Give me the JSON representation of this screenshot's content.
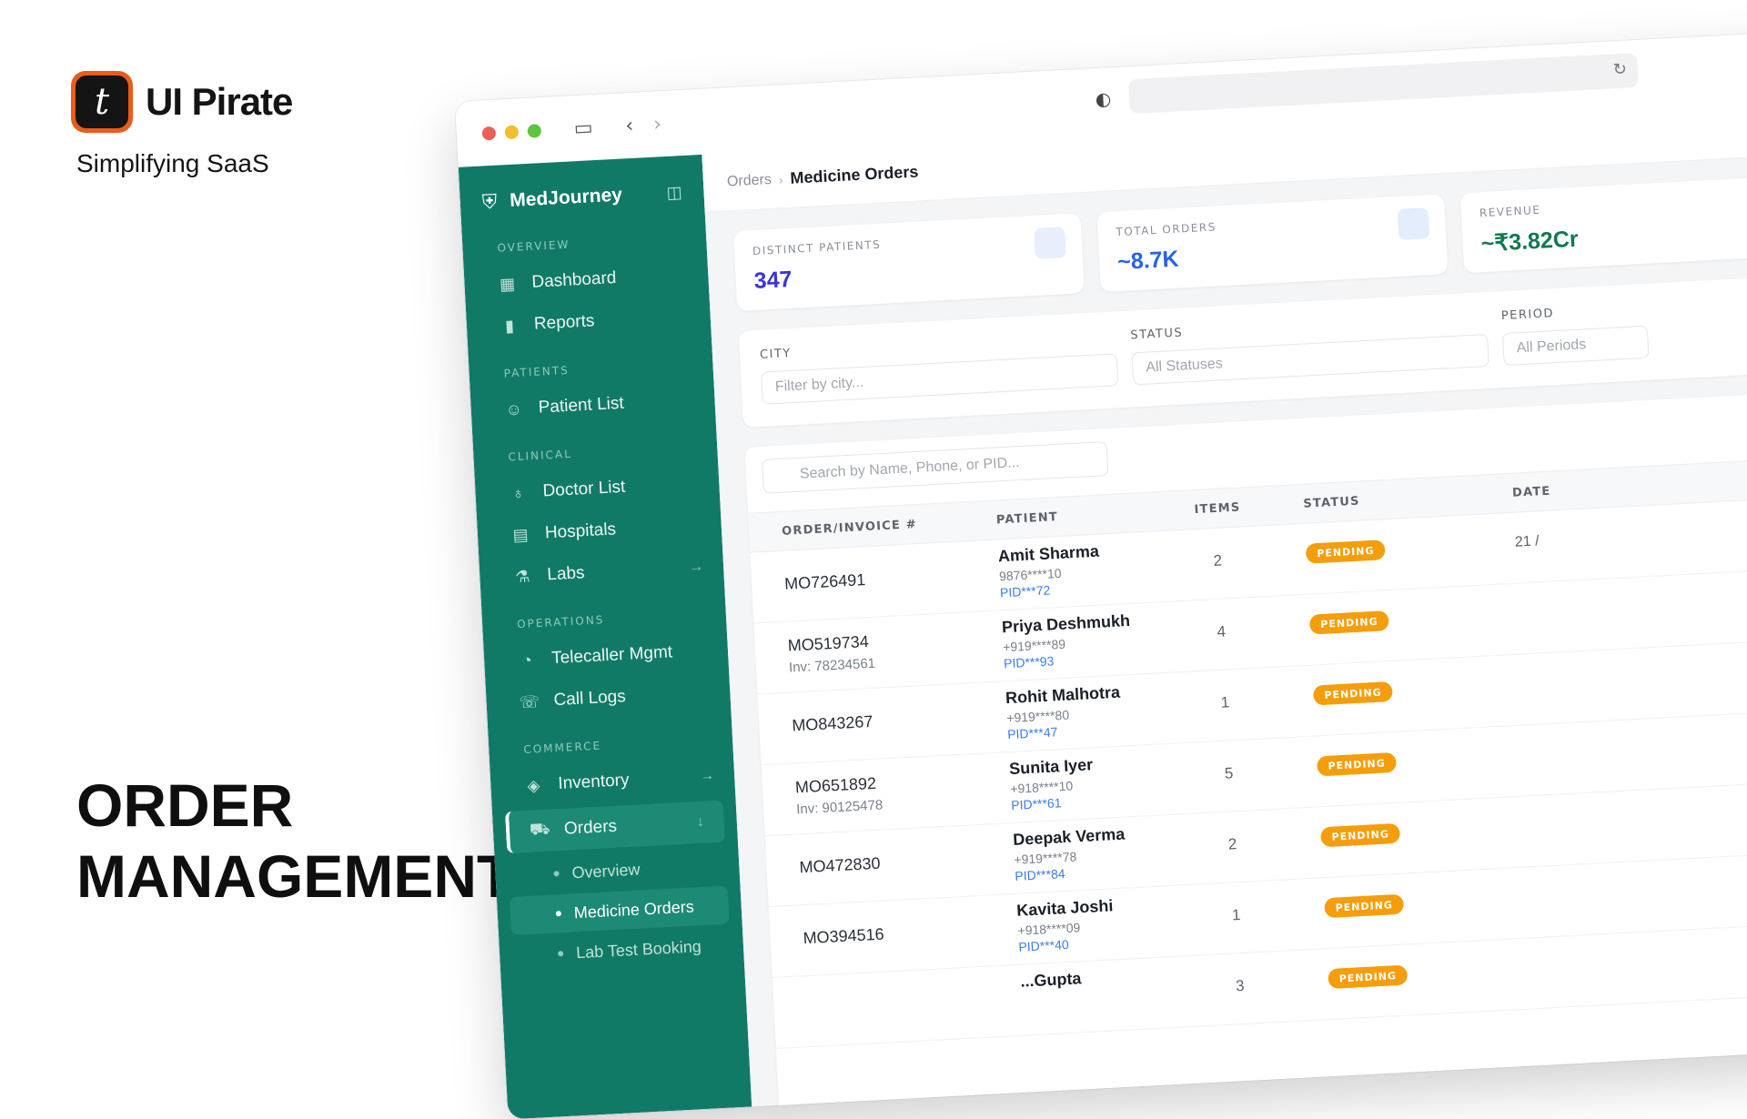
{
  "promo": {
    "brand_name": "UI Pirate",
    "brand_glyph": "t",
    "tagline": "Simplifying SaaS",
    "headline_1": "ORDER",
    "headline_2": "MANAGEMENT",
    "logo_color": "#e85d1a"
  },
  "browser": {
    "dots": [
      "#ec5f57",
      "#f5bd2e",
      "#5fc43f"
    ]
  },
  "sidebar": {
    "brand": "MedJourney",
    "color": "#117a66",
    "sections": [
      {
        "label": "OVERVIEW",
        "items": [
          {
            "label": "Dashboard",
            "icon": "grid-icon"
          },
          {
            "label": "Reports",
            "icon": "bar-chart-icon"
          }
        ]
      },
      {
        "label": "PATIENTS",
        "items": [
          {
            "label": "Patient List",
            "icon": "users-icon"
          }
        ]
      },
      {
        "label": "CLINICAL",
        "items": [
          {
            "label": "Doctor List",
            "icon": "stethoscope-icon"
          },
          {
            "label": "Hospitals",
            "icon": "building-icon"
          },
          {
            "label": "Labs",
            "icon": "microscope-icon"
          }
        ]
      },
      {
        "label": "OPERATIONS",
        "items": [
          {
            "label": "Telecaller Mgmt",
            "icon": "headset-icon"
          },
          {
            "label": "Call Logs",
            "icon": "phone-icon"
          }
        ]
      },
      {
        "label": "COMMERCE",
        "items": [
          {
            "label": "Inventory",
            "icon": "box-icon"
          },
          {
            "label": "Orders",
            "icon": "cart-icon"
          }
        ]
      }
    ],
    "orders_sub": [
      "Overview",
      "Medicine Orders",
      "Lab Test Booking"
    ]
  },
  "topbar": {
    "crumb_parent": "Orders",
    "crumb_current": "Medicine Orders"
  },
  "stats": [
    {
      "label": "DISTINCT PATIENTS",
      "value": "347",
      "color": "#3b35d6"
    },
    {
      "label": "TOTAL ORDERS",
      "value": "~8.7K",
      "color": "#2563eb"
    },
    {
      "label": "REVENUE",
      "value": "~₹3.82Cr",
      "color": "#0f7a4f"
    }
  ],
  "filters": {
    "city_label": "CITY",
    "city_placeholder": "Filter by city...",
    "status_label": "STATUS",
    "status_value": "All Statuses",
    "period_label": "PERIOD",
    "period_value": "All Periods"
  },
  "table": {
    "search_placeholder": "Search by Name, Phone, or PID...",
    "headers": {
      "order": "ORDER/INVOICE #",
      "patient": "PATIENT",
      "items": "ITEMS",
      "status": "STATUS",
      "date": "DATE"
    },
    "rows": [
      {
        "order": "MO726491",
        "inv": "",
        "name": "Amit Sharma",
        "phone": "9876****10",
        "pid": "PID***72",
        "items": "2",
        "status": "PENDING",
        "date": "21 /"
      },
      {
        "order": "MO519734",
        "inv": "Inv: 78234561",
        "name": "Priya Deshmukh",
        "phone": "+919****89",
        "pid": "PID***93",
        "items": "4",
        "status": "PENDING",
        "date": ""
      },
      {
        "order": "MO843267",
        "inv": "",
        "name": "Rohit Malhotra",
        "phone": "+919****80",
        "pid": "PID***47",
        "items": "1",
        "status": "PENDING",
        "date": ""
      },
      {
        "order": "MO651892",
        "inv": "Inv: 90125478",
        "name": "Sunita Iyer",
        "phone": "+918****10",
        "pid": "PID***61",
        "items": "5",
        "status": "PENDING",
        "date": ""
      },
      {
        "order": "MO472830",
        "inv": "",
        "name": "Deepak Verma",
        "phone": "+919****78",
        "pid": "PID***84",
        "items": "2",
        "status": "PENDING",
        "date": ""
      },
      {
        "order": "MO394516",
        "inv": "",
        "name": "Kavita Joshi",
        "phone": "+918****09",
        "pid": "PID***40",
        "items": "1",
        "status": "PENDING",
        "date": ""
      },
      {
        "order": "",
        "inv": "",
        "name": "...Gupta",
        "phone": "",
        "pid": "",
        "items": "3",
        "status": "PENDING",
        "date": ""
      }
    ]
  }
}
